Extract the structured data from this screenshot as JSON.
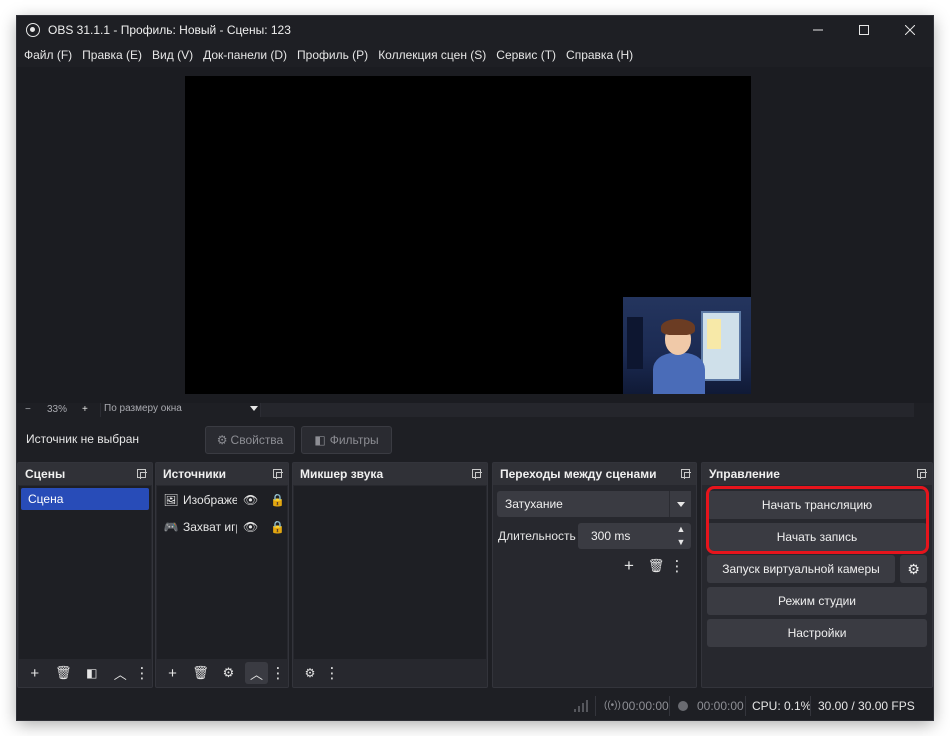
{
  "window": {
    "title": "OBS 31.1.1 - Профиль: Новый - Сцены: 123",
    "app_icon": "obs-logo-icon",
    "controls": [
      "minimize",
      "maximize",
      "close"
    ]
  },
  "menu": [
    "Файл (F)",
    "Правка (E)",
    "Вид (V)",
    "Док-панели (D)",
    "Профиль (P)",
    "Коллекция сцен (S)",
    "Сервис (T)",
    "Справка (H)"
  ],
  "zoom": {
    "minus": "−",
    "value": "33%",
    "plus": "+",
    "mode": "По размеру окна"
  },
  "source_toolbar": {
    "label": "Источник не выбран",
    "properties_label": "Свойства",
    "filters_label": "Фильтры"
  },
  "scenes": {
    "title": "Сцены",
    "items": [
      "Сцена"
    ],
    "selected": "Сцена"
  },
  "sources": {
    "title": "Источники",
    "items": [
      {
        "name": "Изображение",
        "icon": "image-icon"
      },
      {
        "name": "Захват игры",
        "icon": "gamepad-icon"
      }
    ]
  },
  "mixer": {
    "title": "Микшер звука"
  },
  "transitions": {
    "title": "Переходы между сценами",
    "selected": "Затухание",
    "duration_label": "Длительность",
    "duration_value": "300 ms"
  },
  "controls": {
    "title": "Управление",
    "start_stream": "Начать трансляцию",
    "start_record": "Начать запись",
    "virtual_camera": "Запуск виртуальной камеры",
    "studio_mode": "Режим студии",
    "settings": "Настройки"
  },
  "status": {
    "stream_time": "00:00:00",
    "record_time": "00:00:00",
    "cpu": "CPU: 0.1%",
    "fps": "30.00 / 30.00 FPS"
  },
  "colors": {
    "accent": "#284cb8",
    "highlight": "#e6141c",
    "background": "#1e1f24"
  }
}
